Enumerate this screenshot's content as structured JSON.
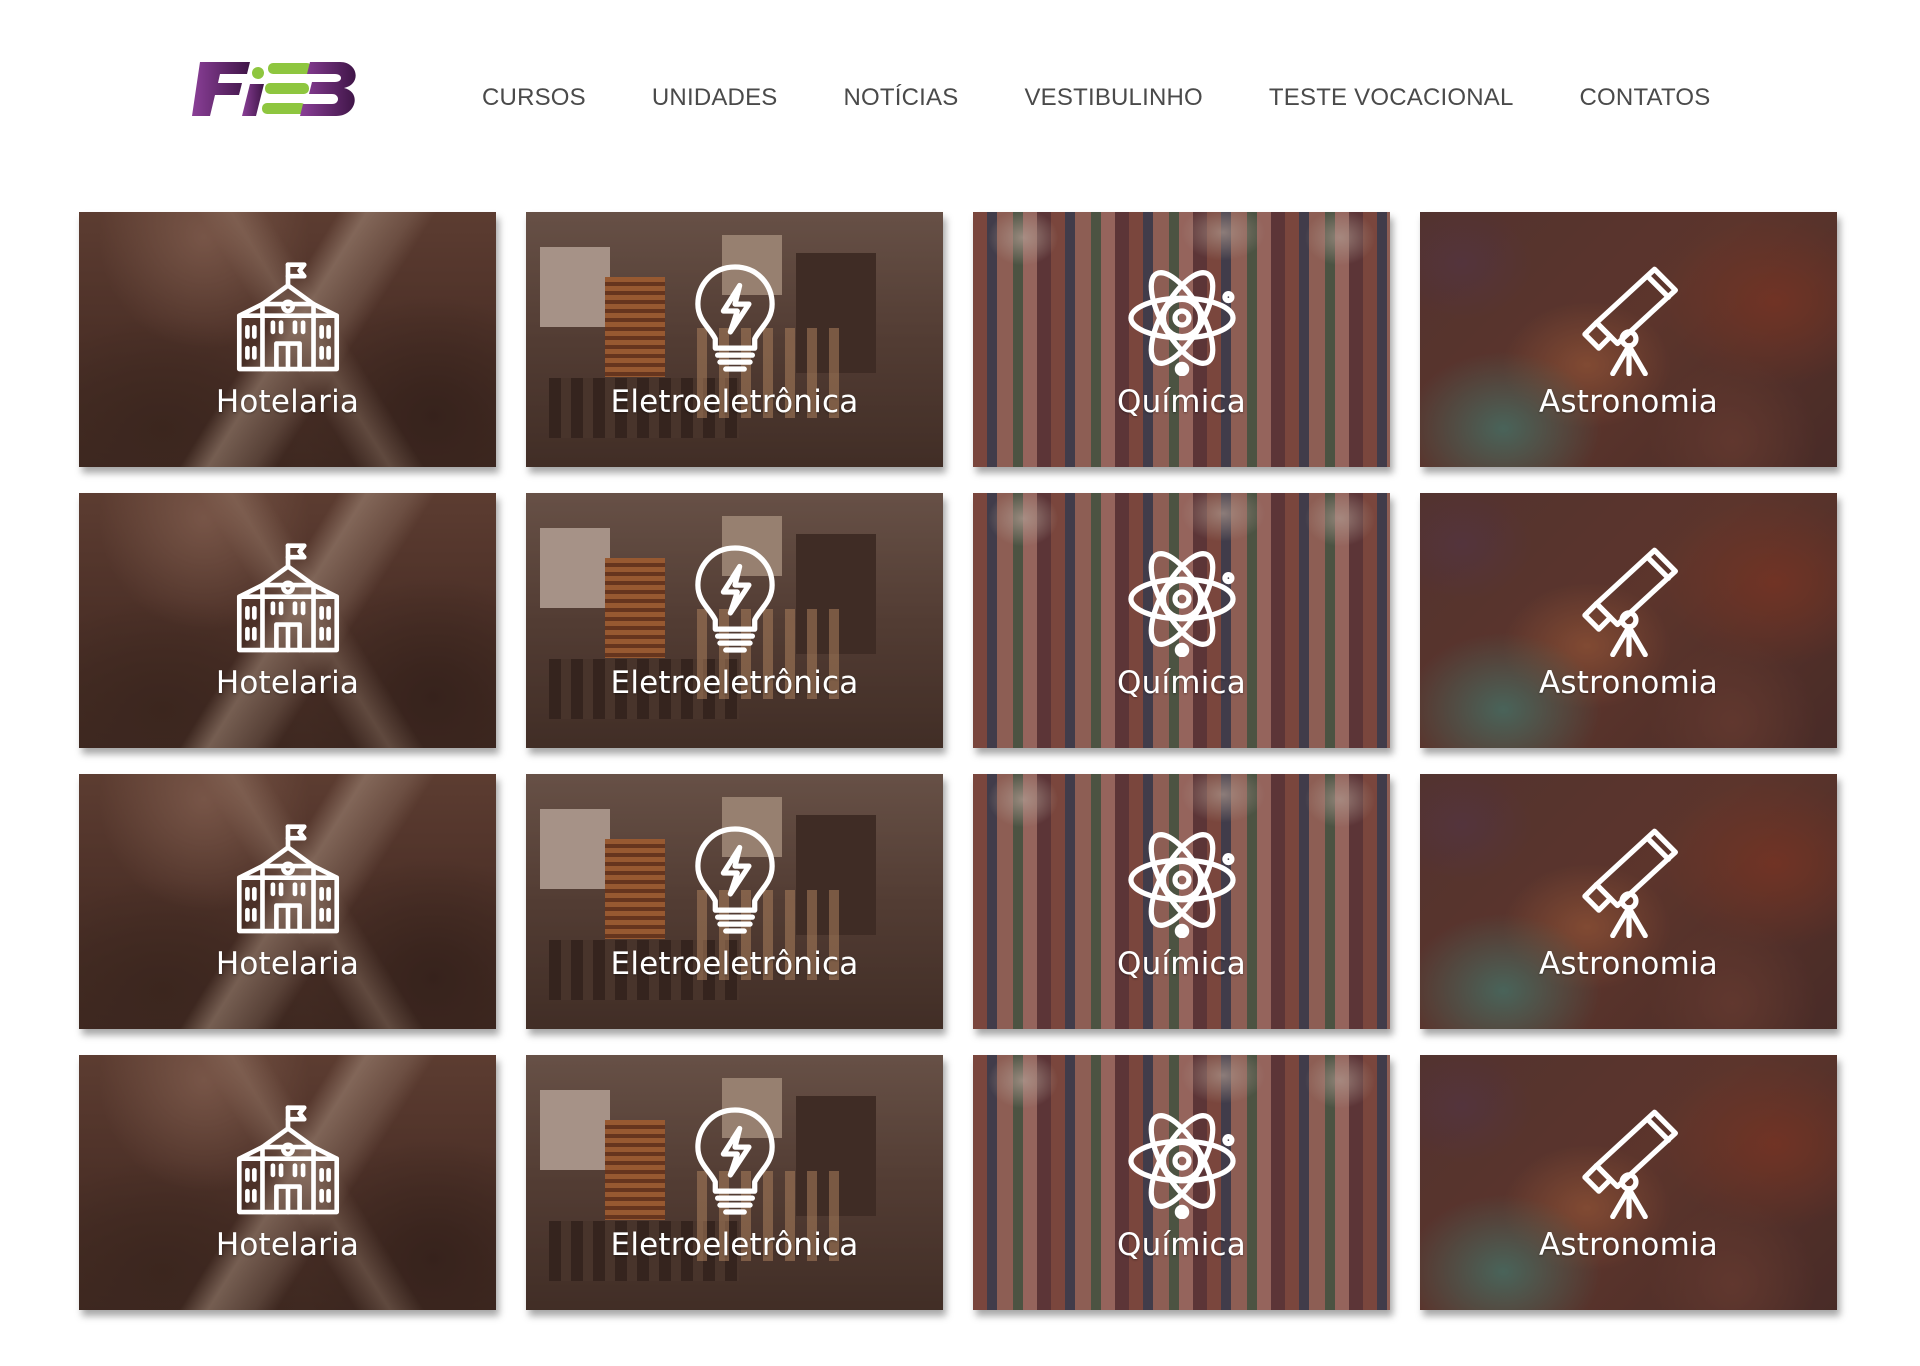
{
  "brand": {
    "logo_text": "FIEB",
    "colors": {
      "purple": "#6b2a7a",
      "green": "#8ec63f"
    }
  },
  "nav": {
    "items": [
      {
        "label": "CURSOS"
      },
      {
        "label": "UNIDADES"
      },
      {
        "label": "NOTÍCIAS"
      },
      {
        "label": "VESTIBULINHO"
      },
      {
        "label": "TESTE VOCACIONAL"
      },
      {
        "label": "CONTATOS"
      }
    ]
  },
  "courses": {
    "rows": [
      [
        {
          "label": "Hotelaria",
          "icon": "school-building-icon"
        },
        {
          "label": "Eletroeletrônica",
          "icon": "lightbulb-bolt-icon"
        },
        {
          "label": "Química",
          "icon": "atom-icon"
        },
        {
          "label": "Astronomia",
          "icon": "telescope-icon"
        }
      ],
      [
        {
          "label": "Hotelaria",
          "icon": "school-building-icon"
        },
        {
          "label": "Eletroeletrônica",
          "icon": "lightbulb-bolt-icon"
        },
        {
          "label": "Química",
          "icon": "atom-icon"
        },
        {
          "label": "Astronomia",
          "icon": "telescope-icon"
        }
      ],
      [
        {
          "label": "Hotelaria",
          "icon": "school-building-icon"
        },
        {
          "label": "Eletroeletrônica",
          "icon": "lightbulb-bolt-icon"
        },
        {
          "label": "Química",
          "icon": "atom-icon"
        },
        {
          "label": "Astronomia",
          "icon": "telescope-icon"
        }
      ],
      [
        {
          "label": "Hotelaria",
          "icon": "school-building-icon"
        },
        {
          "label": "Eletroeletrônica",
          "icon": "lightbulb-bolt-icon"
        },
        {
          "label": "Química",
          "icon": "atom-icon"
        },
        {
          "label": "Astronomia",
          "icon": "telescope-icon"
        }
      ]
    ]
  }
}
